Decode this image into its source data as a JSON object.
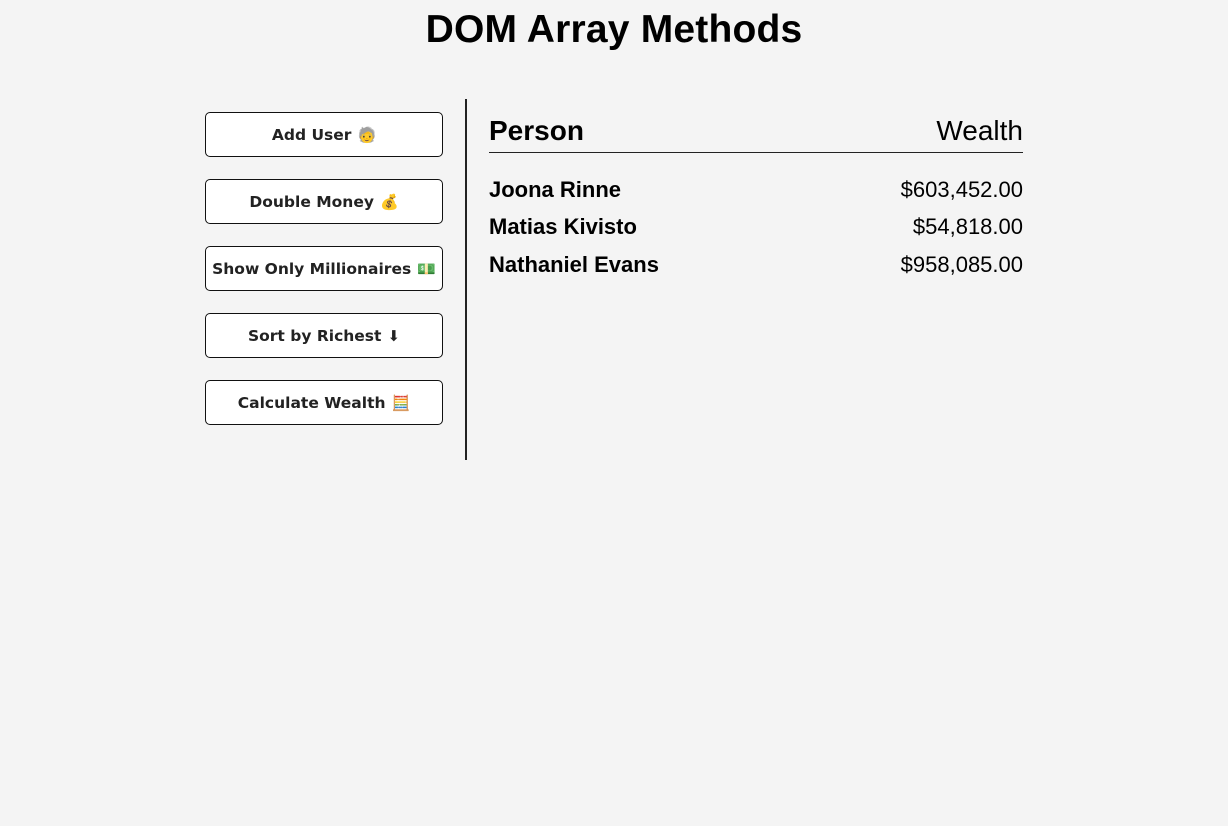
{
  "header": {
    "title": "DOM Array Methods"
  },
  "controls": {
    "buttons": [
      {
        "label": "Add User",
        "icon": "🧓",
        "icon_name": "user-icon"
      },
      {
        "label": "Double Money",
        "icon": "💰",
        "icon_name": "money-bag-icon"
      },
      {
        "label": "Show Only Millionaires",
        "icon": "💵",
        "icon_name": "banknote-icon"
      },
      {
        "label": "Sort by Richest",
        "icon": "⬇",
        "icon_name": "arrow-down-icon"
      },
      {
        "label": "Calculate Wealth",
        "icon": "🧮",
        "icon_name": "abacus-icon"
      }
    ]
  },
  "table": {
    "headers": {
      "person": "Person",
      "wealth": "Wealth"
    },
    "rows": [
      {
        "name": "Joona Rinne",
        "wealth": "$603,452.00"
      },
      {
        "name": "Matias Kivisto",
        "wealth": "$54,818.00"
      },
      {
        "name": "Nathaniel Evans",
        "wealth": "$958,085.00"
      }
    ]
  }
}
